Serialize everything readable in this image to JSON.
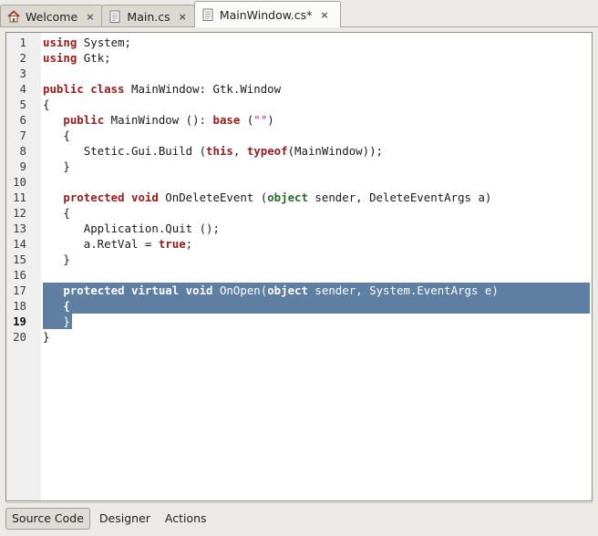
{
  "tabs": [
    {
      "label": "Welcome",
      "icon": "home-icon",
      "active": false
    },
    {
      "label": "Main.cs",
      "icon": "document-icon",
      "active": false
    },
    {
      "label": "MainWindow.cs*",
      "icon": "document-icon",
      "active": true
    }
  ],
  "tab_close_glyph": "×",
  "editor": {
    "current_line": 19,
    "selection_color": "#5e7fa1",
    "keyword_color": "#9b1b1b",
    "type_color": "#2c6b2c",
    "string_color": "#b52aa8",
    "lines": [
      {
        "num": "1",
        "tokens": [
          [
            "kw",
            "using"
          ],
          [
            "t",
            " System;"
          ]
        ]
      },
      {
        "num": "2",
        "tokens": [
          [
            "kw",
            "using"
          ],
          [
            "t",
            " Gtk;"
          ]
        ]
      },
      {
        "num": "3",
        "tokens": []
      },
      {
        "num": "4",
        "tokens": [
          [
            "kw",
            "public class"
          ],
          [
            "t",
            " MainWindow: Gtk.Window"
          ]
        ]
      },
      {
        "num": "5",
        "tokens": [
          [
            "t",
            "{"
          ]
        ]
      },
      {
        "num": "6",
        "tokens": [
          [
            "t",
            "   "
          ],
          [
            "kw",
            "public"
          ],
          [
            "t",
            " MainWindow (): "
          ],
          [
            "kw",
            "base"
          ],
          [
            "t",
            " ("
          ],
          [
            "str",
            "\"\""
          ],
          [
            "t",
            ")"
          ]
        ]
      },
      {
        "num": "7",
        "tokens": [
          [
            "t",
            "   {"
          ]
        ]
      },
      {
        "num": "8",
        "tokens": [
          [
            "t",
            "      Stetic.Gui.Build ("
          ],
          [
            "kw",
            "this"
          ],
          [
            "t",
            ", "
          ],
          [
            "kw",
            "typeof"
          ],
          [
            "t",
            "(MainWindow));"
          ]
        ]
      },
      {
        "num": "9",
        "tokens": [
          [
            "t",
            "   }"
          ]
        ]
      },
      {
        "num": "10",
        "tokens": []
      },
      {
        "num": "11",
        "tokens": [
          [
            "t",
            "   "
          ],
          [
            "kw",
            "protected void"
          ],
          [
            "t",
            " OnDeleteEvent ("
          ],
          [
            "ty",
            "object"
          ],
          [
            "t",
            " sender, DeleteEventArgs a)"
          ]
        ]
      },
      {
        "num": "12",
        "tokens": [
          [
            "t",
            "   {"
          ]
        ]
      },
      {
        "num": "13",
        "tokens": [
          [
            "t",
            "      Application.Quit ();"
          ]
        ]
      },
      {
        "num": "14",
        "tokens": [
          [
            "t",
            "      a.RetVal = "
          ],
          [
            "kw",
            "true"
          ],
          [
            "t",
            ";"
          ]
        ]
      },
      {
        "num": "15",
        "tokens": [
          [
            "t",
            "   }"
          ]
        ]
      },
      {
        "num": "16",
        "tokens": []
      },
      {
        "num": "17",
        "tokens": [
          [
            "t",
            "   "
          ],
          [
            "kw",
            "protected virtual void"
          ],
          [
            "t",
            " OnOpen("
          ],
          [
            "kw",
            "object"
          ],
          [
            "t",
            " sender, System.EventArgs e)"
          ]
        ],
        "selected": "full"
      },
      {
        "num": "18",
        "tokens": [
          [
            "t",
            "   "
          ],
          [
            "kw",
            "{"
          ]
        ],
        "selected": "full"
      },
      {
        "num": "19",
        "tokens": [
          [
            "t",
            "   }"
          ]
        ],
        "selected": "partial"
      },
      {
        "num": "20",
        "tokens": [
          [
            "t",
            "}"
          ]
        ]
      }
    ]
  },
  "bottom_tabs": [
    {
      "label": "Source Code",
      "active": true
    },
    {
      "label": "Designer",
      "active": false
    },
    {
      "label": "Actions",
      "active": false
    }
  ]
}
